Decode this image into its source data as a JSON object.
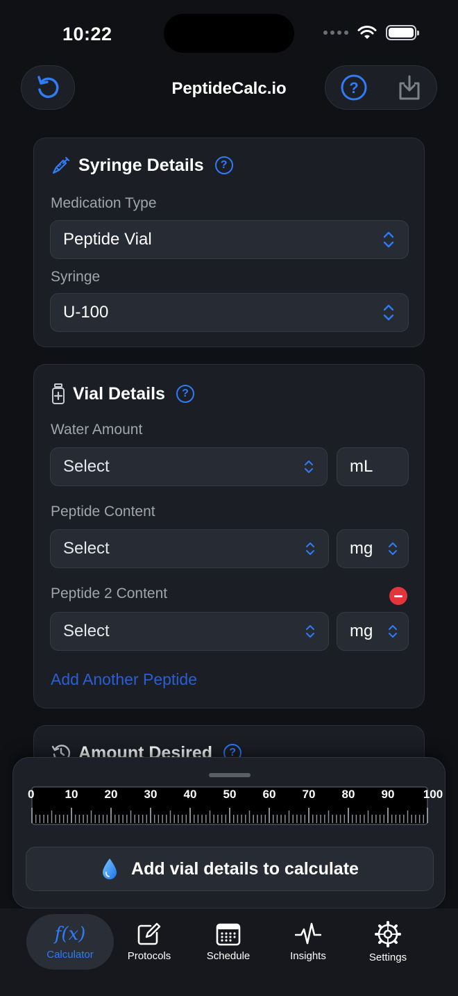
{
  "status": {
    "time": "10:22"
  },
  "header": {
    "title": "PeptideCalc.io"
  },
  "syringe_card": {
    "title": "Syringe Details",
    "medication_label": "Medication Type",
    "medication_value": "Peptide Vial",
    "syringe_label": "Syringe",
    "syringe_value": "U-100"
  },
  "vial_card": {
    "title": "Vial Details",
    "water_label": "Water Amount",
    "water_value": "Select",
    "water_unit": "mL",
    "peptide_label": "Peptide Content",
    "peptide_value": "Select",
    "peptide_unit": "mg",
    "peptide2_label": "Peptide 2 Content",
    "peptide2_value": "Select",
    "peptide2_unit": "mg",
    "add_link": "Add Another Peptide"
  },
  "amount_card": {
    "title": "Amount Desired"
  },
  "sheet": {
    "ruler_ticks": [
      "0",
      "10",
      "20",
      "30",
      "40",
      "50",
      "60",
      "70",
      "80",
      "90",
      "100"
    ],
    "calc_label": "Add vial details to calculate"
  },
  "tabs": [
    {
      "label": "Calculator"
    },
    {
      "label": "Protocols"
    },
    {
      "label": "Schedule"
    },
    {
      "label": "Insights"
    },
    {
      "label": "Settings"
    }
  ],
  "colors": {
    "accent": "#2f7cf6",
    "danger": "#e5353c",
    "background": "#0f1115",
    "card": "#1b1e25"
  }
}
